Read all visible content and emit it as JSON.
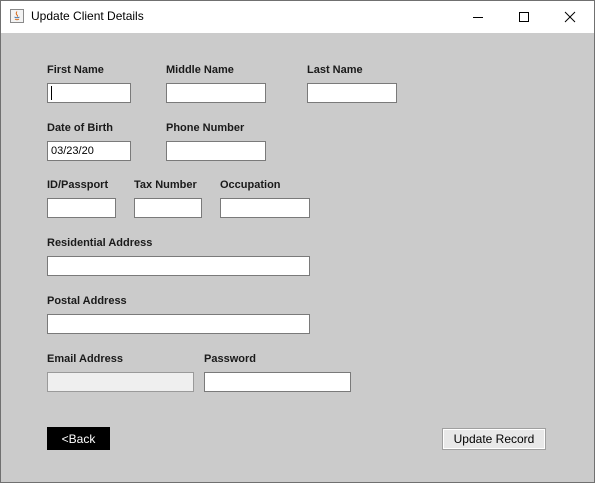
{
  "window": {
    "title": "Update Client Details",
    "icons": {
      "app": "java-app-icon",
      "minimize": "minimize-icon",
      "maximize": "maximize-icon",
      "close": "close-icon"
    }
  },
  "form": {
    "first_name": {
      "label": "First Name",
      "value": ""
    },
    "middle_name": {
      "label": "Middle Name",
      "value": ""
    },
    "last_name": {
      "label": "Last Name",
      "value": ""
    },
    "date_of_birth": {
      "label": "Date of Birth",
      "value": "03/23/20"
    },
    "phone_number": {
      "label": "Phone Number",
      "value": ""
    },
    "id_passport": {
      "label": "ID/Passport",
      "value": ""
    },
    "tax_number": {
      "label": "Tax Number",
      "value": ""
    },
    "occupation": {
      "label": "Occupation",
      "value": ""
    },
    "residential_address": {
      "label": "Residential Address",
      "value": ""
    },
    "postal_address": {
      "label": "Postal Address",
      "value": ""
    },
    "email_address": {
      "label": "Email Address",
      "value": ""
    },
    "password": {
      "label": "Password",
      "value": ""
    }
  },
  "buttons": {
    "back": "<Back",
    "update_record": "Update Record"
  }
}
